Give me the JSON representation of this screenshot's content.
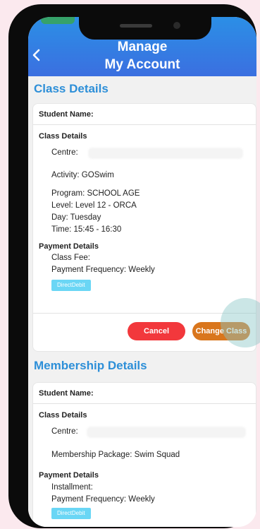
{
  "header": {
    "title_line1": "Manage",
    "title_line2": "My Account"
  },
  "class_section": {
    "title": "Class Details",
    "student_name_label": "Student Name:",
    "class_details_heading": "Class Details",
    "centre": "Centre:",
    "activity": "Activity: GOSwim",
    "program": "Program: SCHOOL AGE",
    "level": "Level: Level 12 - ORCA",
    "day": "Day: Tuesday",
    "time": "Time: 15:45 - 16:30",
    "payment_heading": "Payment Details",
    "class_fee": "Class Fee:",
    "payment_frequency": "Payment Frequency: Weekly",
    "payment_method_badge": "DirectDebit",
    "cancel_button": "Cancel",
    "change_class_button": "Change Class"
  },
  "membership_section": {
    "title": "Membership Details",
    "student_name_label": "Student Name:",
    "class_details_heading": "Class Details",
    "centre": "Centre:",
    "membership_package": "Membership Package: Swim Squad",
    "payment_heading": "Payment Details",
    "installment": "Installment:",
    "payment_frequency": "Payment Frequency: Weekly",
    "payment_method_badge": "DirectDebit"
  },
  "colors": {
    "header_gradient_top": "#2b8fe6",
    "header_gradient_bottom": "#3b6fe0",
    "section_title": "#2d8fd8",
    "cancel": "#f2383c",
    "change_class": "#d9761d",
    "badge": "#6ad6f5"
  }
}
